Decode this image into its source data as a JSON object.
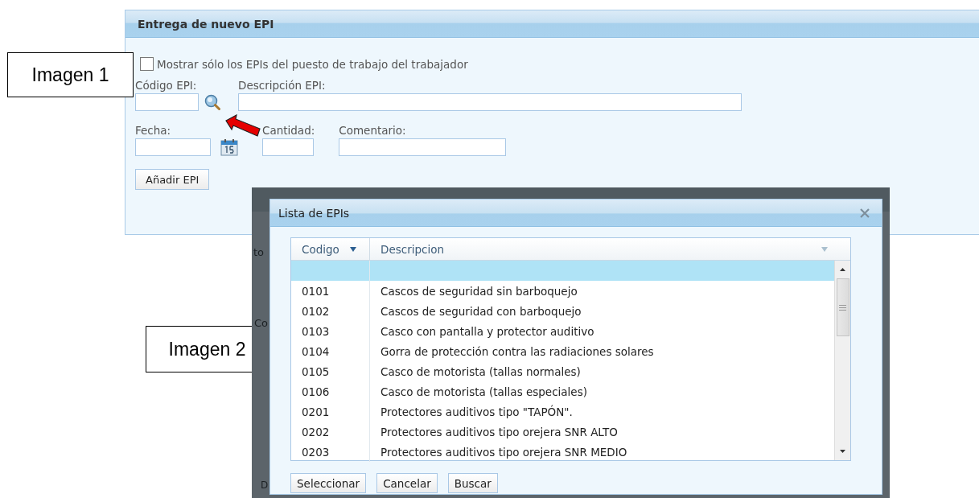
{
  "callouts": [
    {
      "text": "Imagen 1"
    },
    {
      "text": "Imagen 2"
    }
  ],
  "form": {
    "title": "Entrega de nuevo EPI",
    "checkbox": {
      "label": "Mostrar sólo los EPIs del puesto de trabajo del trabajador",
      "checked": false
    },
    "rows": [
      [
        {
          "label": "Código EPI:",
          "kind": "lookup"
        },
        {
          "label": "Descripción EPI:",
          "kind": "text"
        }
      ],
      [
        {
          "label": "Fecha:",
          "kind": "date"
        },
        {
          "label": "Cantidad:",
          "kind": "text"
        },
        {
          "label": "Comentario:",
          "kind": "text"
        }
      ]
    ],
    "button": "Añadir EPI"
  },
  "backdrop_fragments": [
    "to",
    "Co",
    "D"
  ],
  "dialog": {
    "title": "Lista de EPIs",
    "columns": [
      {
        "label": "Codigo",
        "sort_active": true
      },
      {
        "label": "Descripcion",
        "sort_active": false
      }
    ],
    "rows": [
      {
        "selected": true
      },
      {
        "code": "0101",
        "description": "Cascos de seguridad sin barboquejo",
        "selected": false
      },
      {
        "code": "0102",
        "description": "Cascos de seguridad con barboquejo",
        "selected": false
      },
      {
        "code": "0103",
        "description": "Casco con pantalla y protector auditivo",
        "selected": false
      },
      {
        "code": "0104",
        "description": "Gorra de protección contra las radiaciones solares",
        "selected": false
      },
      {
        "code": "0105",
        "description": "Casco de motorista (tallas normales)",
        "selected": false
      },
      {
        "code": "0106",
        "description": "Casco de motorista (tallas especiales)",
        "selected": false
      },
      {
        "code": "0201",
        "description": "Protectores auditivos tipo \"TAPÓN\".",
        "selected": false
      },
      {
        "code": "0202",
        "description": "Protectores auditivos tipo orejera SNR ALTO",
        "selected": false
      },
      {
        "code": "0203",
        "description": "Protectores auditivos tipo orejera SNR MEDIO",
        "selected": false
      }
    ],
    "buttons": [
      "Seleccionar",
      "Cancelar",
      "Buscar"
    ]
  }
}
